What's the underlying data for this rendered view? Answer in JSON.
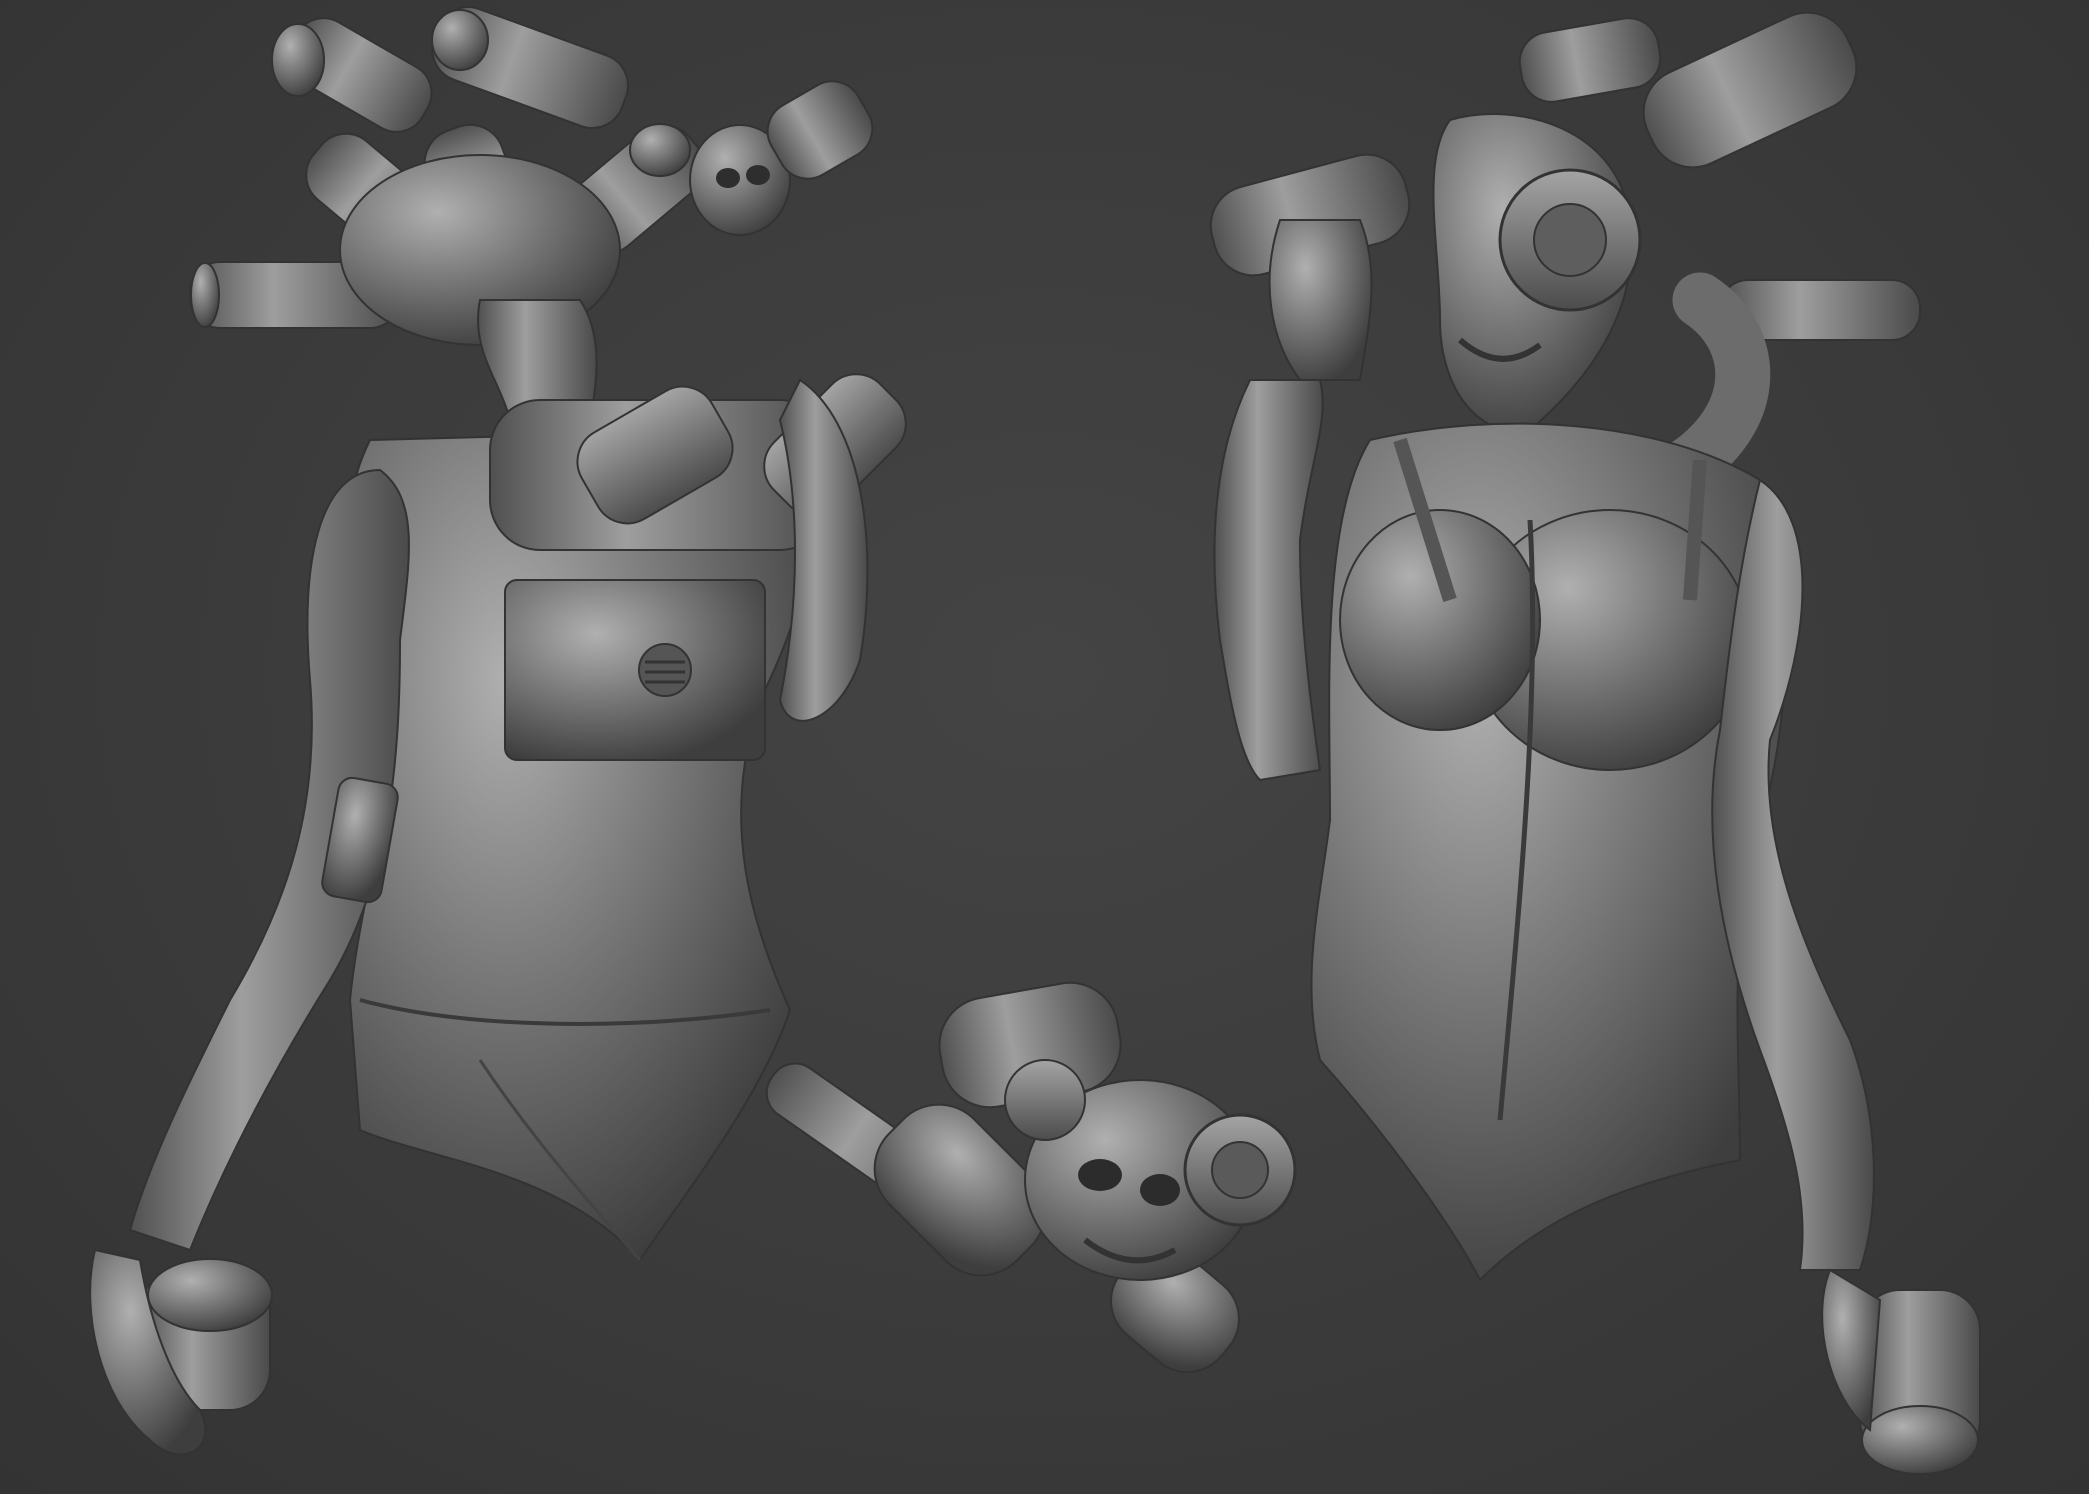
{
  "scene": {
    "background_color": "#3a3a3a",
    "material_color": "#7a7a7a",
    "views": [
      {
        "name": "back-view-figure"
      },
      {
        "name": "helmet-skull-detail"
      },
      {
        "name": "front-view-figure"
      }
    ]
  }
}
